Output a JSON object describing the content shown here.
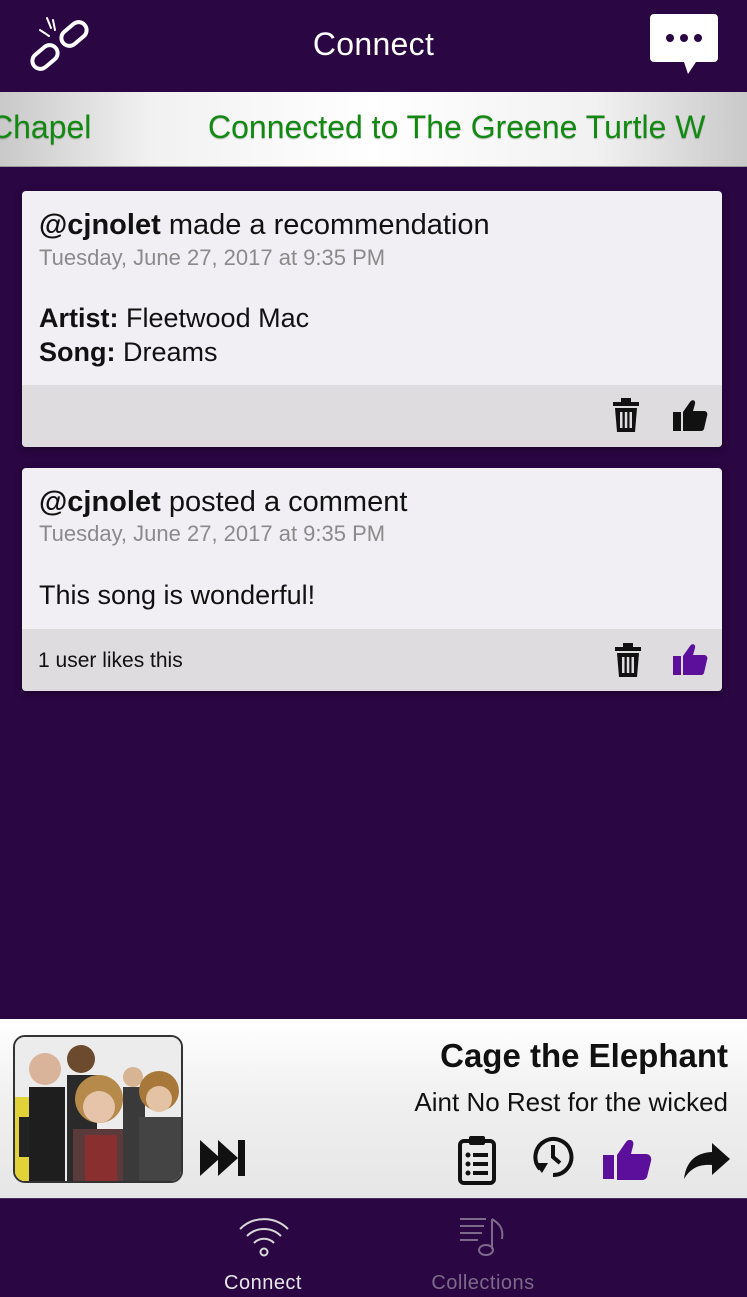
{
  "nav": {
    "title": "Connect",
    "left_icon": "broken-link-icon",
    "right_icon": "chat-bubble-icon"
  },
  "ticker": {
    "text_left": "Chapel",
    "text_right": "Connected to The Greene Turtle W",
    "color": "#128a12"
  },
  "feed": [
    {
      "user": "@cjnolet",
      "action": "made a recommendation",
      "date": "Tuesday, June 27, 2017 at 9:35 PM",
      "artist_label": "Artist:",
      "artist": "Fleetwood Mac",
      "song_label": "Song:",
      "song": "Dreams",
      "likes_text": "",
      "liked": false
    },
    {
      "user": "@cjnolet",
      "action": "posted a comment",
      "date": "Tuesday, June 27, 2017 at 9:35 PM",
      "body": "This song is wonderful!",
      "likes_text": "1 user likes this",
      "liked": true
    }
  ],
  "player": {
    "artist": "Cage the Elephant",
    "song": "Aint No Rest for the wicked",
    "liked": true,
    "buttons": [
      "skip-forward-icon",
      "queue-list-icon",
      "history-icon",
      "thumbs-up-icon",
      "share-icon"
    ]
  },
  "tabs": [
    {
      "label": "Connect",
      "icon": "wifi-icon",
      "active": true
    },
    {
      "label": "Collections",
      "icon": "music-list-icon",
      "active": false
    }
  ],
  "colors": {
    "background": "#2a0642",
    "accent_purple": "#5b0f9b",
    "card": "#f1eff4",
    "card_footer": "#dedcdf"
  }
}
